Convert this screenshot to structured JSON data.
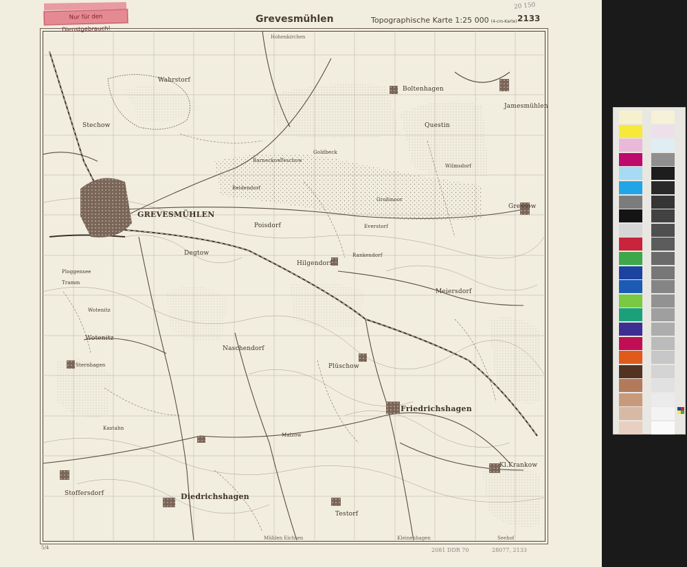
{
  "header": {
    "title": "Grevesmühlen",
    "scale": "Topographische Karte 1:25 000",
    "scale_note": "(4-cm-Karte)",
    "sheet_number": "2133",
    "pencil_note": "20 150"
  },
  "stamp": {
    "text": "Nur für den Dienstgebrauch!"
  },
  "footer": {
    "left": "2081 DDR 70",
    "right": "28077, 2133",
    "code_left": "5/4"
  },
  "edges": {
    "top_center": "Hohenkirchen",
    "bottom_center": "Mühlen Eichsen",
    "bottom_right1": "Kleinenhagen",
    "bottom_right2": "Seehof"
  },
  "places": {
    "grevesmuehlen": "GREVESMÜHLEN",
    "wotenitz": "Wotenitz",
    "diedrichshagen": "Diedrichshagen",
    "friedrichshagen": "Friedrichshagen",
    "hilgendorf": "Hilgendorf",
    "meiersdorf": "Meiersdorf",
    "plueschow": "Plüschow",
    "kleinkrankow": "Kl.Krankow",
    "testorf": "Testorf",
    "questin": "Questin",
    "bobitzer": "Boltenhagen",
    "gressow": "Gressow",
    "jamesmuehlen": "Jamesmühlen",
    "wahrstorf": "Wahrstorf",
    "degtow": "Degtow",
    "poisdorf": "Poisdorf",
    "stechow": "Stechow",
    "wotenitz2": "Wotenitz",
    "naschendorf": "Naschendorf",
    "rankendorf": "Rankendorf",
    "everstorf": "Everstorf",
    "kastahn": "Kastahn",
    "malzow": "Malzow",
    "gosde": "Goldbeck",
    "beidendorf": "Beidendorf",
    "grossmoor": "Großmoor",
    "barneckow": "Barneckow",
    "tramm": "Tramm",
    "stoffersdorf": "Stoffersdorf",
    "wilmsdorf": "Wilmsdorf",
    "sternhagen": "Sternhagen",
    "ploggensee": "Ploggensee",
    "teschow": "Teschow"
  },
  "calibration": {
    "left_colors": [
      "#f5f1cf",
      "#f7e93a",
      "#eab8d9",
      "#bd0a6c",
      "#a6dbf3",
      "#20a6e7",
      "#7c7c7c",
      "#141414",
      "#d6d6d6",
      "#c8243b",
      "#3ea74a",
      "#1c43a0",
      "#1c5bb4",
      "#79c943",
      "#1aa17a",
      "#3c2e93",
      "#c10d55",
      "#e05a1c",
      "#533221",
      "#b27a5a",
      "#c89a7c",
      "#d8b9a4",
      "#e7cfc1"
    ],
    "right_colors": [
      "#f6f1d8",
      "#eee0ea",
      "#e1edf5",
      "#8f8f8f",
      "#1d1d1d",
      "#292929",
      "#353535",
      "#424242",
      "#4f4f4f",
      "#5c5c5c",
      "#6a6a6a",
      "#777777",
      "#858585",
      "#929292",
      "#9f9f9f",
      "#adadad",
      "#babbba",
      "#c7c7c7",
      "#d4d4d4",
      "#e1e1e1",
      "#ebebeb",
      "#f3f3f3",
      "#fafafa"
    ]
  },
  "colors": {
    "paper": "#f1eee0",
    "ink": "#4a3d33",
    "background": "#1a1a1a"
  }
}
